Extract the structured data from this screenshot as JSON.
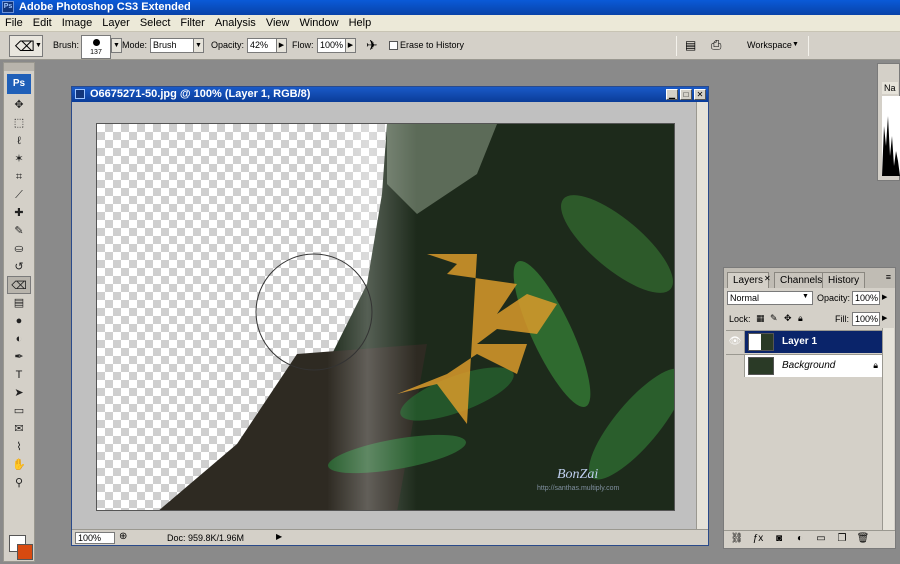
{
  "app": {
    "title": "Adobe Photoshop CS3 Extended",
    "badge": "Ps"
  },
  "menu": [
    "File",
    "Edit",
    "Image",
    "Layer",
    "Select",
    "Filter",
    "Analysis",
    "View",
    "Window",
    "Help"
  ],
  "options": {
    "brush_label": "Brush:",
    "brush_size": "137",
    "mode_label": "Mode:",
    "mode_value": "Brush",
    "opacity_label": "Opacity:",
    "opacity_value": "42%",
    "flow_label": "Flow:",
    "flow_value": "100%",
    "erase_to_history": "Erase to History",
    "workspace": "Workspace"
  },
  "toolbox": {
    "logo": "Ps",
    "tools": [
      {
        "name": "move-tool",
        "glyph": "✥"
      },
      {
        "name": "marquee-tool",
        "glyph": "⬚"
      },
      {
        "name": "lasso-tool",
        "glyph": "ℓ"
      },
      {
        "name": "magic-wand-tool",
        "glyph": "✶"
      },
      {
        "name": "crop-tool",
        "glyph": "⌗"
      },
      {
        "name": "slice-tool",
        "glyph": "⟋"
      },
      {
        "name": "healing-brush-tool",
        "glyph": "✚"
      },
      {
        "name": "brush-tool",
        "glyph": "✎"
      },
      {
        "name": "clone-stamp-tool",
        "glyph": "⛀"
      },
      {
        "name": "history-brush-tool",
        "glyph": "↺"
      },
      {
        "name": "eraser-tool",
        "glyph": "⌫",
        "active": true
      },
      {
        "name": "gradient-tool",
        "glyph": "▤"
      },
      {
        "name": "blur-tool",
        "glyph": "●"
      },
      {
        "name": "dodge-tool",
        "glyph": "◐"
      },
      {
        "name": "pen-tool",
        "glyph": "✒"
      },
      {
        "name": "type-tool",
        "glyph": "T"
      },
      {
        "name": "path-selection-tool",
        "glyph": "➤"
      },
      {
        "name": "shape-tool",
        "glyph": "▭"
      },
      {
        "name": "notes-tool",
        "glyph": "✉"
      },
      {
        "name": "eyedropper-tool",
        "glyph": "⌇"
      },
      {
        "name": "hand-tool",
        "glyph": "✋"
      },
      {
        "name": "zoom-tool",
        "glyph": "⚲"
      }
    ],
    "fg_color": "#ffffff",
    "bg_color": "#d84a10"
  },
  "document": {
    "title": "O6675271-50.jpg @ 100% (Layer 1, RGB/8)",
    "zoom": "100%",
    "doc_info": "Doc: 959.8K/1.96M",
    "watermark_name": "BonZai",
    "watermark_url": "http://santhas.multiply.com"
  },
  "navigator": {
    "tab": "Na"
  },
  "layers": {
    "tabs": [
      "Layers",
      "Channels",
      "History"
    ],
    "blend_mode": "Normal",
    "opacity_label": "Opacity:",
    "opacity_value": "100%",
    "lock_label": "Lock:",
    "fill_label": "Fill:",
    "fill_value": "100%",
    "items": [
      {
        "name": "Layer 1",
        "selected": true,
        "visible": true
      },
      {
        "name": "Background",
        "selected": false,
        "visible": false,
        "locked": true
      }
    ],
    "footer_icons": [
      "link-icon",
      "fx-icon",
      "mask-icon",
      "adjustment-icon",
      "group-icon",
      "new-layer-icon",
      "trash-icon"
    ]
  }
}
